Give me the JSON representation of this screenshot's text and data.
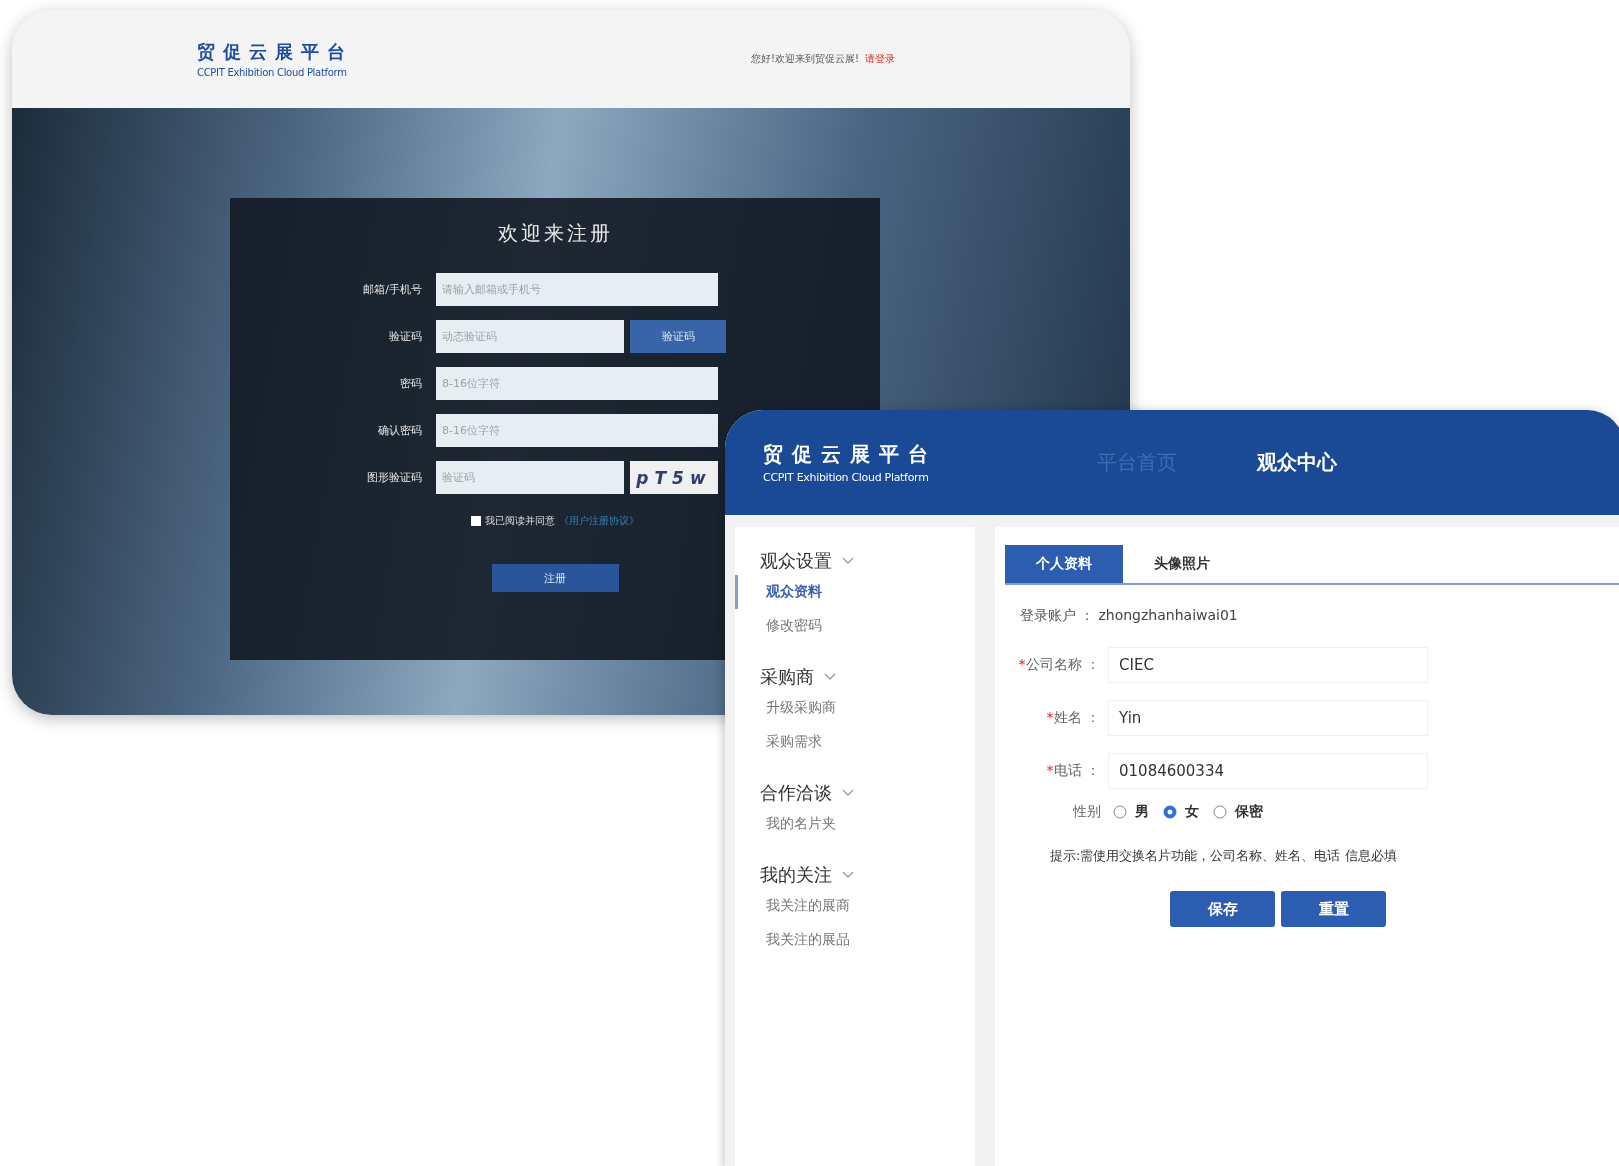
{
  "registration_window": {
    "header": {
      "logo_title": "贸促云展平台",
      "logo_subtitle": "CCPIT Exhibition Cloud Platform",
      "greeting": "您好!欢迎来到贸促云展!",
      "login_link": "请登录"
    },
    "form": {
      "title": "欢迎来注册",
      "fields": [
        {
          "kind": "text",
          "label": "邮箱/手机号",
          "placeholder": "请输入邮箱或手机号"
        },
        {
          "kind": "code",
          "label": "验证码",
          "placeholder": "动态验证码",
          "button": "验证码"
        },
        {
          "kind": "text",
          "label": "密码",
          "placeholder": "8-16位字符"
        },
        {
          "kind": "text",
          "label": "确认密码",
          "placeholder": "8-16位字符"
        },
        {
          "kind": "captcha",
          "label": "图形验证码",
          "placeholder": "验证码",
          "captcha": "pT5w"
        }
      ],
      "agreement": {
        "checked": false,
        "text": "我已阅读并同意",
        "link": "《用户注册协议》"
      },
      "submit": "注册"
    }
  },
  "profile_window": {
    "header": {
      "logo_title": "贸促云展平台",
      "logo_subtitle": "CCPIT Exhibition Cloud Platform",
      "nav": [
        {
          "label": "平台首页",
          "selected": false
        },
        {
          "label": "观众中心",
          "selected": true
        }
      ]
    },
    "sidebar": {
      "groups": [
        {
          "label": "观众设置",
          "expanded": true,
          "items": [
            {
              "label": "观众资料",
              "selected": true
            },
            {
              "label": "修改密码",
              "selected": false
            }
          ]
        },
        {
          "label": "采购商",
          "expanded": true,
          "items": [
            {
              "label": "升级采购商",
              "selected": false
            },
            {
              "label": "采购需求",
              "selected": false
            }
          ]
        },
        {
          "label": "合作洽谈",
          "expanded": true,
          "items": [
            {
              "label": "我的名片夹",
              "selected": false
            }
          ]
        },
        {
          "label": "我的关注",
          "expanded": true,
          "items": [
            {
              "label": "我关注的展商",
              "selected": false
            },
            {
              "label": "我关注的展品",
              "selected": false
            }
          ]
        }
      ]
    },
    "tabs": [
      {
        "label": "个人资料",
        "selected": true
      },
      {
        "label": "头像照片",
        "selected": false
      }
    ],
    "account": {
      "label": "登录账户 ：",
      "value": "zhongzhanhaiwai01"
    },
    "fields": [
      {
        "required": true,
        "mark": "*",
        "label": "公司名称 ：",
        "value": "CIEC"
      },
      {
        "required": true,
        "mark": "*",
        "label": "姓名 ：",
        "value": "Yin"
      },
      {
        "required": true,
        "mark": "*",
        "label": "电话 ：",
        "value": "01084600334"
      }
    ],
    "gender": {
      "label": "性别",
      "options": [
        {
          "label": "男",
          "selected": false
        },
        {
          "label": "女",
          "selected": true
        },
        {
          "label": "保密",
          "selected": false
        }
      ]
    },
    "hint": "提示:需使用交换名片功能，公司名称、姓名、电话 信息必填",
    "buttons": [
      "保存",
      "重置"
    ]
  }
}
